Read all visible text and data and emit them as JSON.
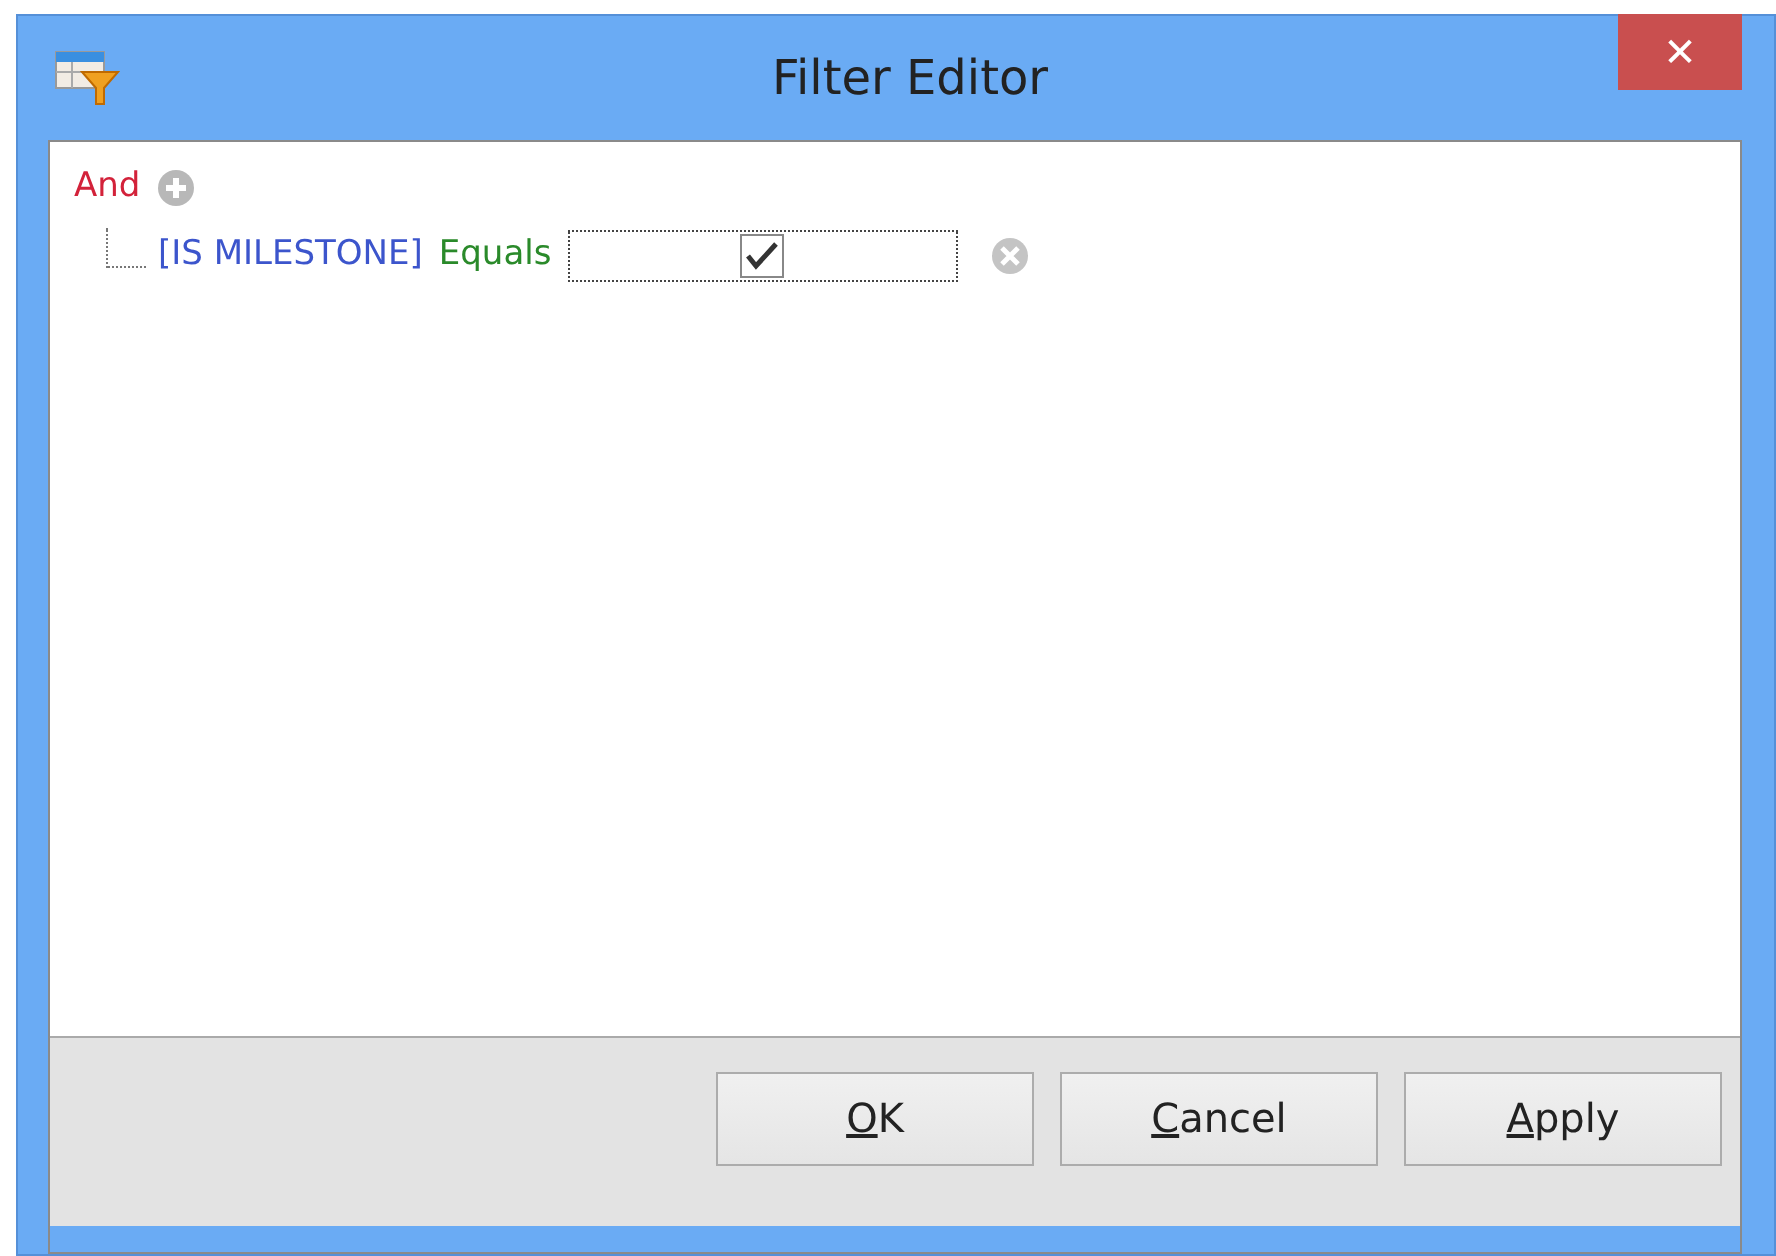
{
  "window": {
    "title": "Filter Editor",
    "close_glyph": "✕"
  },
  "filter": {
    "group": "And",
    "conditions": [
      {
        "field": "[IS MILESTONE]",
        "operator": "Equals",
        "kind": "checkbox",
        "checked": true
      }
    ]
  },
  "buttons": [
    {
      "access_key": "O",
      "label_rest": "K"
    },
    {
      "access_key": "C",
      "label_rest": "ancel"
    },
    {
      "access_key": "A",
      "label_rest": "pply"
    }
  ]
}
